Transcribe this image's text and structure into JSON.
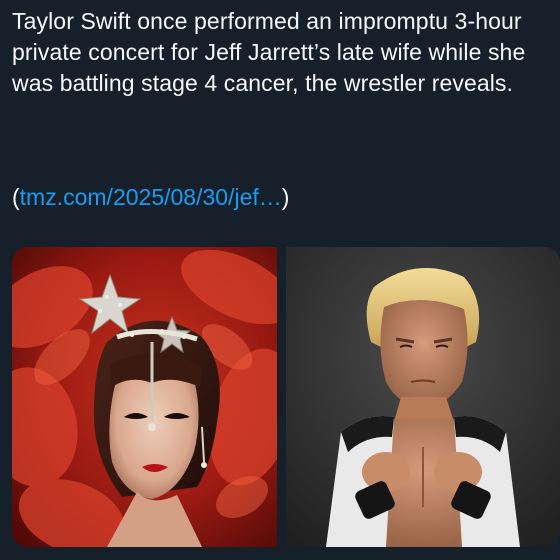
{
  "post": {
    "text": "Taylor Swift once performed an impromptu 3-hour private concert for Jeff Jarrett’s late wife while she was battling stage 4 cancer, the wrestler reveals.",
    "link_open": "(",
    "link_text": "tmz.com/2025/08/30/jef…",
    "link_close": ")"
  },
  "media": {
    "items": [
      {
        "subject": "Taylor Swift in jeweled star headpiece with red feathers"
      },
      {
        "subject": "Jeff Jarrett in wrestling pose"
      }
    ]
  },
  "colors": {
    "background": "#15202b",
    "text": "#f5f8fa",
    "link": "#1d9bf0"
  }
}
